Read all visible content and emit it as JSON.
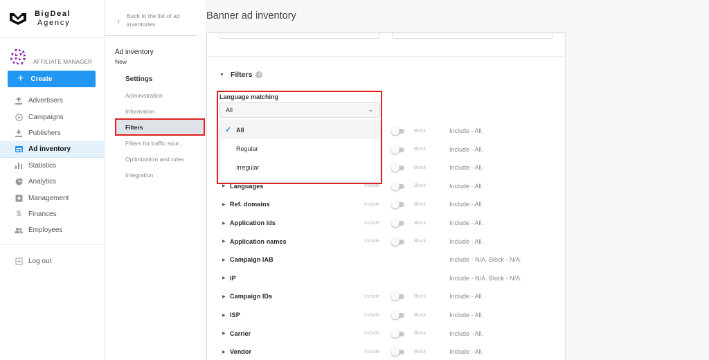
{
  "brand": {
    "line1": "BigDeal",
    "line2": "Agency"
  },
  "role": "AFFILIATE MANAGER",
  "create_label": "Create",
  "nav": [
    {
      "label": "Advertisers",
      "icon": "upload-icon",
      "active": false
    },
    {
      "label": "Campaigns",
      "icon": "play-circle-icon",
      "active": false
    },
    {
      "label": "Publishers",
      "icon": "download-icon",
      "active": false
    },
    {
      "label": "Ad inventory",
      "icon": "ad-inventory-icon",
      "active": true
    },
    {
      "label": "Statistics",
      "icon": "bar-chart-icon",
      "active": false
    },
    {
      "label": "Analytics",
      "icon": "pie-chart-icon",
      "active": false
    },
    {
      "label": "Management",
      "icon": "management-icon",
      "active": false
    },
    {
      "label": "Finances",
      "icon": "dollar-icon",
      "active": false
    },
    {
      "label": "Employees",
      "icon": "people-icon",
      "active": false
    }
  ],
  "logout_label": "Log out",
  "subnav": {
    "back_label": "Back to the list of ad inventories",
    "title": "Ad inventory",
    "subtitle": "New",
    "settings_label": "Settings",
    "items": [
      {
        "label": "Administration",
        "active": false
      },
      {
        "label": "Information",
        "active": false
      },
      {
        "label": "Filters",
        "active": true
      },
      {
        "label": "Filters for traffic sour...",
        "active": false
      },
      {
        "label": "Optimization and rules",
        "active": false
      },
      {
        "label": "Integration",
        "active": false
      }
    ]
  },
  "page_title": "Banner ad inventory",
  "filters": {
    "heading": "Filters",
    "language_matching": {
      "label": "Language matching",
      "value": "All",
      "options": [
        {
          "label": "All",
          "selected": true
        },
        {
          "label": "Regular",
          "selected": false
        },
        {
          "label": "Irregular",
          "selected": false
        }
      ]
    },
    "include_label": "Include",
    "block_label": "Block",
    "rows": [
      {
        "name": "",
        "toggle": true,
        "summary": "Include - All."
      },
      {
        "name": "",
        "toggle": true,
        "summary": "Include - All."
      },
      {
        "name": "",
        "toggle": true,
        "summary": "Include - All."
      },
      {
        "name": "Languages",
        "toggle": true,
        "summary": "Include - All."
      },
      {
        "name": "Ref. domains",
        "toggle": true,
        "summary": "Include - All."
      },
      {
        "name": "Application ids",
        "toggle": true,
        "summary": "Include - All."
      },
      {
        "name": "Application names",
        "toggle": true,
        "summary": "Include - All."
      },
      {
        "name": "Campaign IAB",
        "toggle": false,
        "summary": "Include - N/A. Block - N/A."
      },
      {
        "name": "IP",
        "toggle": false,
        "summary": "Include - N/A. Block - N/A."
      },
      {
        "name": "Campaign IDs",
        "toggle": true,
        "summary": "Include - All."
      },
      {
        "name": "ISP",
        "toggle": true,
        "summary": "Include - All."
      },
      {
        "name": "Carrier",
        "toggle": true,
        "summary": "Include - All."
      },
      {
        "name": "Vendor",
        "toggle": true,
        "summary": "Include - All."
      }
    ]
  }
}
